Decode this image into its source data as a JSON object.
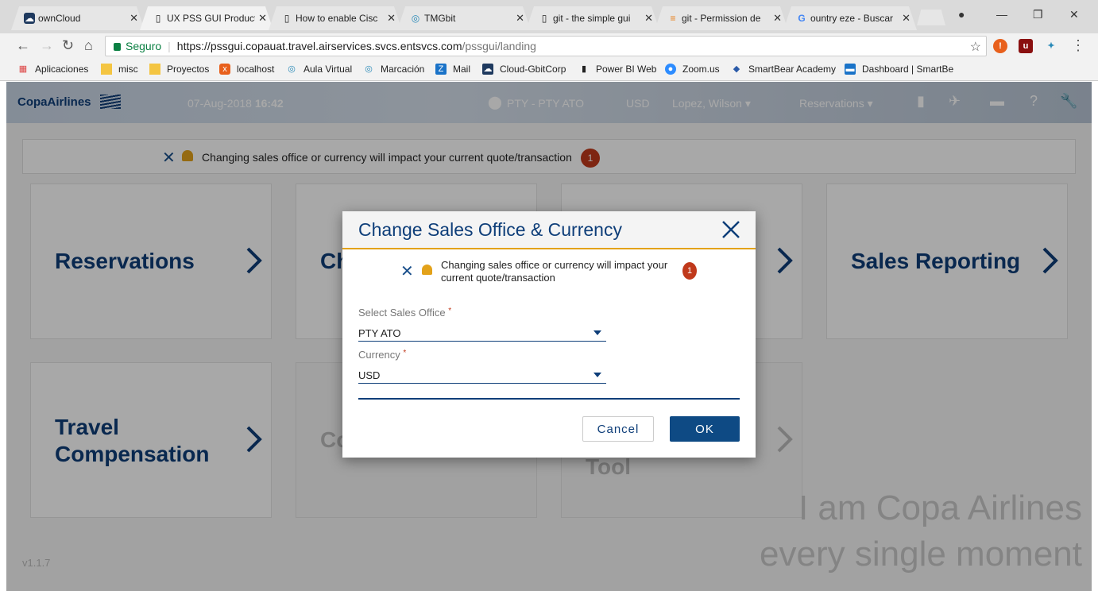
{
  "browser": {
    "tabs": [
      {
        "title": "ownCloud",
        "icon": "cloud-icon"
      },
      {
        "title": "UX PSS GUI Product",
        "icon": "page-icon"
      },
      {
        "title": "How to enable Cisc",
        "icon": "page-icon"
      },
      {
        "title": "TMGbit",
        "icon": "circle-icon"
      },
      {
        "title": "git - the simple gui",
        "icon": "page-icon"
      },
      {
        "title": "git - Permission de",
        "icon": "stackoverflow-icon"
      },
      {
        "title": "ountry eze - Buscar",
        "icon": "google-icon"
      }
    ],
    "close_glyph": "✕",
    "secure_label": "Seguro",
    "url_host": "https://pssgui.copauat.travel.airservices.svcs.entsvcs.com",
    "url_path": "/pssgui/landing",
    "bookmarks": [
      {
        "label": "Aplicaciones",
        "color": "#d44"
      },
      {
        "label": "misc",
        "color": "#f4c542"
      },
      {
        "label": "Proyectos",
        "color": "#f4c542"
      },
      {
        "label": "localhost",
        "color": "#e8601c"
      },
      {
        "label": "Aula Virtual",
        "color": "#2a8ab8"
      },
      {
        "label": "Marcación",
        "color": "#2a8ab8"
      },
      {
        "label": "Mail",
        "color": "#1a73c8"
      },
      {
        "label": "Cloud-GbitCorp",
        "color": "#1f3a5f"
      },
      {
        "label": "Power BI Web",
        "color": "#222"
      },
      {
        "label": "Zoom.us",
        "color": "#2d8cff"
      },
      {
        "label": "SmartBear Academy",
        "color": "#2a5aa8"
      },
      {
        "label": "Dashboard | SmartBe",
        "color": "#1a73c8"
      }
    ]
  },
  "header": {
    "logo": "CopaAirlines",
    "date": "07-Aug-2018",
    "time": "16:42",
    "location": "PTY - PTY ATO",
    "currency": "USD",
    "user": "Lopez, Wilson ▾",
    "menu": "Reservations ▾"
  },
  "banner": {
    "text": "Changing sales office or currency will impact your current quote/transaction",
    "badge": "1"
  },
  "cards": [
    {
      "title": "Reservations",
      "enabled": true
    },
    {
      "title": "Ch",
      "enabled": true
    },
    {
      "title": "",
      "enabled": true
    },
    {
      "title": "Sales Reporting",
      "enabled": true
    },
    {
      "title": "Travel Compensation",
      "enabled": true
    },
    {
      "title": "Co",
      "enabled": false
    },
    {
      "title": "Tool",
      "enabled": false
    }
  ],
  "watermark": {
    "line1": "I am Copa Airlines",
    "line2": "every single moment"
  },
  "version": "v1.1.7",
  "modal": {
    "title": "Change Sales Office & Currency",
    "warning": "Changing sales office or currency will impact your current quote/transaction",
    "badge": "1",
    "sales_office_label": "Select Sales Office",
    "sales_office_value": "PTY ATO",
    "currency_label": "Currency",
    "currency_value": "USD",
    "required_mark": "*",
    "cancel": "Cancel",
    "ok": "OK"
  },
  "colors": {
    "brand": "#0e3e79",
    "accent": "#e3a21a",
    "alert": "#c0391b"
  }
}
